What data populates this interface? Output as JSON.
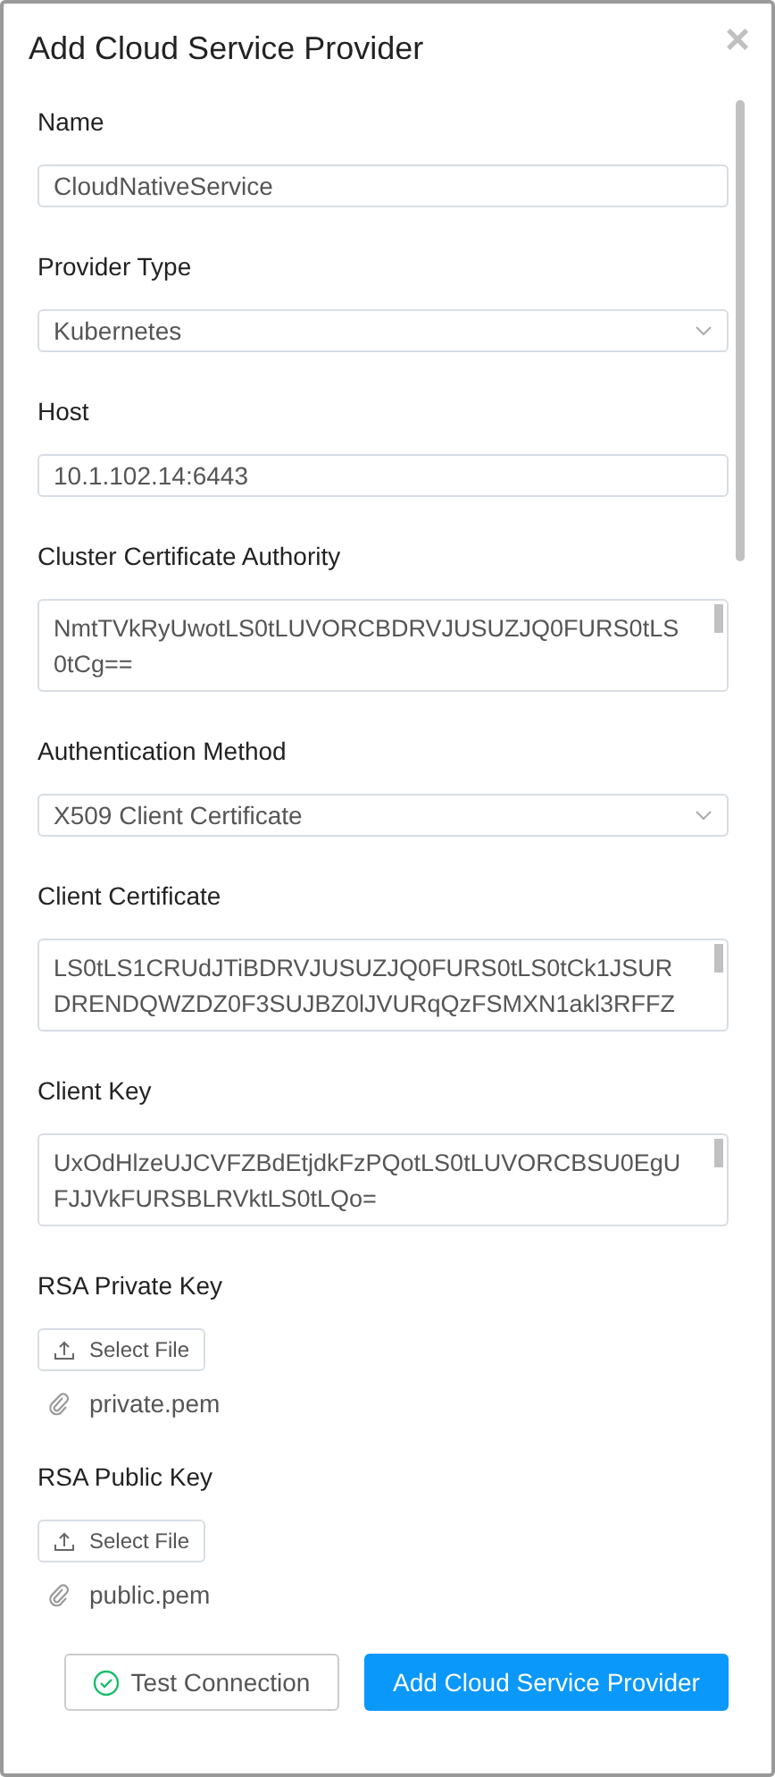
{
  "dialog": {
    "title": "Add Cloud Service Provider",
    "close_icon": "×"
  },
  "fields": [
    {
      "kind": "input",
      "label": "Name",
      "value": "CloudNativeService"
    },
    {
      "kind": "select",
      "label": "Provider Type",
      "value": "Kubernetes"
    },
    {
      "kind": "input",
      "label": "Host",
      "value": "10.1.102.14:6443"
    },
    {
      "kind": "textarea",
      "label": "Cluster Certificate Authority",
      "lines": [
        "NmtTVkRyUwotLS0tLUVORCBDRVJUSUZJQ0FURS0tLS",
        "0tCg=="
      ]
    },
    {
      "kind": "select",
      "label": "Authentication Method",
      "value": "X509 Client Certificate"
    },
    {
      "kind": "textarea",
      "label": "Client Certificate",
      "lines": [
        "LS0tLS1CRUdJTiBDRVJUSUZJQ0FURS0tLS0tCk1JSUR",
        "DRENDQWZDZ0F3SUJBZ0lJVURqQzFSMXN1akl3RFFZ"
      ]
    },
    {
      "kind": "textarea",
      "label": "Client Key",
      "lines": [
        "UxOdHlzeUJCVFZBdEtjdkFzPQotLS0tLUVORCBSU0EgU",
        "FJJVkFURSBLRVktLS0tLQo="
      ]
    },
    {
      "kind": "file",
      "label": "RSA Private Key",
      "button": "Select File",
      "file": "private.pem"
    },
    {
      "kind": "file",
      "label": "RSA Public Key",
      "button": "Select File",
      "file": "public.pem"
    }
  ],
  "buttons": [
    {
      "kind": "test",
      "label": "Test Connection"
    },
    {
      "kind": "primary",
      "label": "Add Cloud Service Provider"
    }
  ]
}
